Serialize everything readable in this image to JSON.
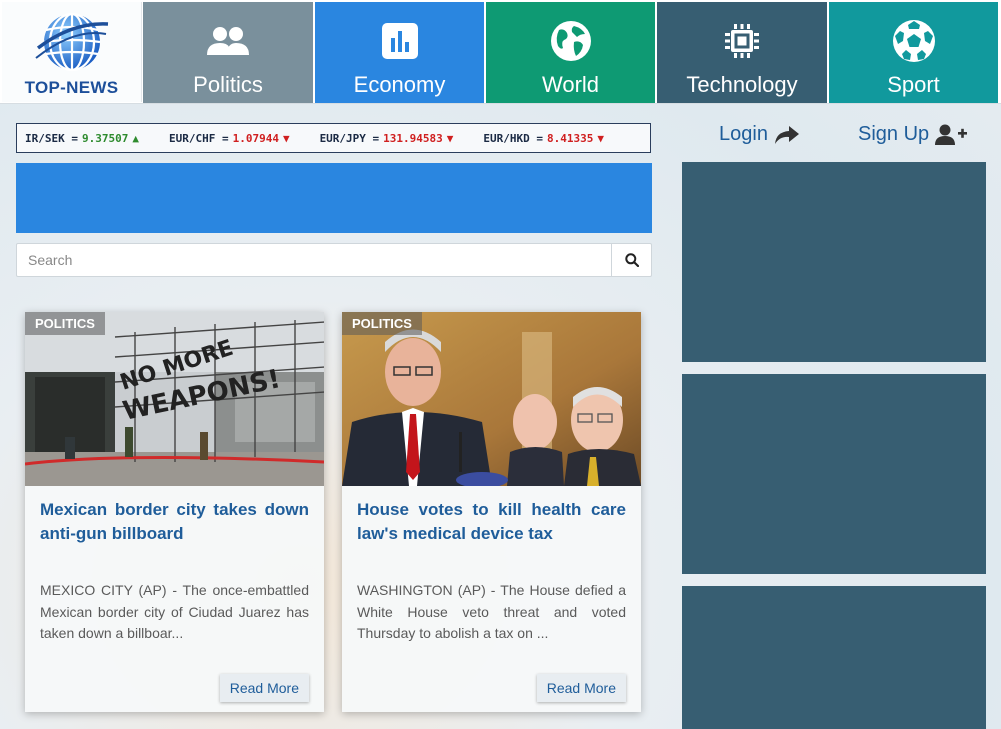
{
  "logo": {
    "text": "TOP-NEWS"
  },
  "nav": [
    {
      "label": "Politics",
      "icon": "users-icon",
      "color": "#7a909c"
    },
    {
      "label": "Economy",
      "icon": "bar-chart-icon",
      "color": "#2a86e0"
    },
    {
      "label": "World",
      "icon": "globe-icon",
      "color": "#0e9a73"
    },
    {
      "label": "Technology",
      "icon": "chip-icon",
      "color": "#375e72"
    },
    {
      "label": "Sport",
      "icon": "soccer-ball-icon",
      "color": "#11999d"
    }
  ],
  "ticker": [
    {
      "pair": "IR/SEK =",
      "value": "9.37507",
      "trend": "up"
    },
    {
      "pair": "EUR/CHF =",
      "value": "1.07944",
      "trend": "down"
    },
    {
      "pair": "EUR/JPY =",
      "value": "131.94583",
      "trend": "down"
    },
    {
      "pair": "EUR/HKD =",
      "value": "8.41335",
      "trend": "down"
    }
  ],
  "search": {
    "placeholder": "Search"
  },
  "auth": {
    "login": "Login",
    "signup": "Sign Up"
  },
  "articles": [
    {
      "category": "POLITICS",
      "title": "Mexican border city takes down anti-gun billboard",
      "excerpt": "MEXICO CITY (AP) - The once-embattled Mexican border city of Ciudad Juarez has taken down a billboar...",
      "read_more": "Read More",
      "image_text": "NO MORE WEAPONS!"
    },
    {
      "category": "POLITICS",
      "title": "House votes to kill health care law's medical device tax",
      "excerpt": "WASHINGTON (AP) - The House defied a White House veto threat and voted Thursday to abolish a tax on ...",
      "read_more": "Read More"
    }
  ],
  "colors": {
    "accent": "#1f5d9a",
    "banner": "#2a86e0",
    "side_panel": "#375e72"
  }
}
